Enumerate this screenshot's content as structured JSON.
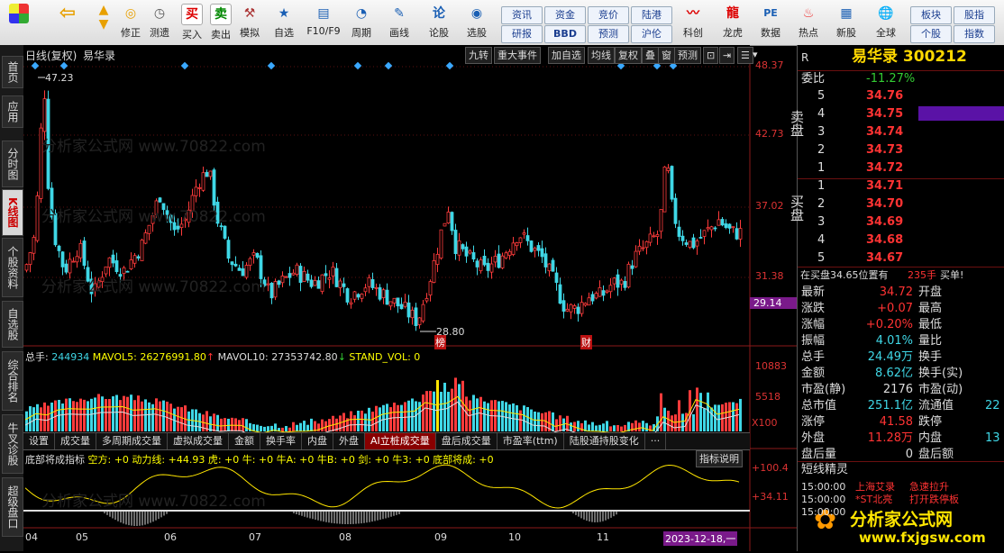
{
  "toolbar": {
    "items": [
      "修正",
      "测遗",
      "买入",
      "卖出",
      "模拟",
      "自选",
      "F10/F9",
      "周期",
      "画线",
      "论股",
      "选股",
      "科创",
      "龙虎",
      "数据",
      "热点",
      "新股",
      "全球"
    ],
    "small_buttons": [
      "资讯",
      "资金",
      "竞价",
      "陆港",
      "研报",
      "BBD",
      "预测",
      "沪伦",
      "板块",
      "股指",
      "个股",
      "指数"
    ]
  },
  "leftnav": [
    "首页",
    "应用",
    "分时图",
    "K线图",
    "个股资料",
    "自选股",
    "综合排名",
    "牛叉诊股",
    "超级盘口"
  ],
  "chart_header": {
    "mode": "日线(复权)",
    "name": "易华录"
  },
  "chart_buttons": [
    "九转",
    "重大事件",
    "加自选",
    "均线",
    "复权",
    "叠",
    "窗",
    "预测"
  ],
  "price_axis": [
    "48.37",
    "42.73",
    "37.02",
    "31.38",
    "29.14"
  ],
  "annotations": {
    "high": "47.23",
    "low": "28.80",
    "marker1": "榜",
    "marker2": "财"
  },
  "watermark": "分析家公式网 www.70822.com",
  "volume_header": {
    "label": "总手:",
    "v": "244934",
    "mavol5": "MAVOL5: 26276991.80",
    "mavol10": "MAVOL10: 27353742.80",
    "stand": "STAND_VOL: 0"
  },
  "volume_axis": [
    "10883",
    "5518",
    "X100"
  ],
  "sub_tabs": [
    "设置",
    "成交量",
    "多周期成交量",
    "虚拟成交量",
    "金额",
    "换手率",
    "内盘",
    "外盘",
    "AI立桩成交量",
    "盘后成交量",
    "市盈率(ttm)",
    "陆股通持股变化",
    "···"
  ],
  "indicator_header": {
    "name": "底部将成指标",
    "text": "空方: +0  动力线: +44.93  虎: +0  牛: +0  牛A: +0  牛B: +0  剑: +0  牛3: +0  底部将成: +0",
    "button": "指标说明"
  },
  "indicator_axis": [
    "+100.4",
    "+34.11"
  ],
  "dates": [
    "04",
    "05",
    "06",
    "07",
    "08",
    "09",
    "10",
    "11",
    "2023-12-18,一"
  ],
  "stock": {
    "title": "易华录 300212",
    "r": "R",
    "weibi_label": "委比",
    "weibi": "-11.27%"
  },
  "sell": [
    {
      "n": "5",
      "p": "34.76"
    },
    {
      "n": "4",
      "p": "34.75"
    },
    {
      "n": "3",
      "p": "34.74"
    },
    {
      "n": "2",
      "p": "34.73"
    },
    {
      "n": "1",
      "p": "34.72"
    }
  ],
  "buy": [
    {
      "n": "1",
      "p": "34.71"
    },
    {
      "n": "2",
      "p": "34.70"
    },
    {
      "n": "3",
      "p": "34.69"
    },
    {
      "n": "4",
      "p": "34.68"
    },
    {
      "n": "5",
      "p": "34.67"
    }
  ],
  "sell_label": "卖盘",
  "buy_label": "买盘",
  "tick": {
    "text": "在买盘34.65位置有",
    "amt": "235手",
    "tag": "买单!"
  },
  "quote": [
    {
      "k": "最新",
      "v": "34.72",
      "k2": "开盘"
    },
    {
      "k": "涨跌",
      "v": "+0.07",
      "k2": "最高"
    },
    {
      "k": "涨幅",
      "v": "+0.20%",
      "k2": "最低"
    },
    {
      "k": "振幅",
      "v": "4.01%",
      "k2": "量比"
    },
    {
      "k": "总手",
      "v": "24.49万",
      "k2": "换手"
    },
    {
      "k": "金额",
      "v": "8.62亿",
      "k2": "换手(实)"
    },
    {
      "k": "市盈(静)",
      "v": "2176",
      "k2": "市盈(动)"
    },
    {
      "k": "总市值",
      "v": "251.1亿",
      "k2": "流通值",
      "v2": "22"
    },
    {
      "k": "涨停",
      "v": "41.58",
      "k2": "跌停"
    },
    {
      "k": "外盘",
      "v": "11.28万",
      "k2": "内盘",
      "v2": "13"
    },
    {
      "k": "盘后量",
      "v": "0",
      "k2": "盘后额"
    }
  ],
  "short_title": "短线精灵",
  "short_list": [
    {
      "t": "15:00:00",
      "s": "上海艾录",
      "e": "急速拉升"
    },
    {
      "t": "15:00:00",
      "s": "*ST北亮",
      "e": "打开跌停板"
    },
    {
      "t": "15:00:00",
      "s": "",
      "e": ""
    }
  ],
  "logo": {
    "text": "分析家公式网",
    "url": "www.fxjgsw.com"
  },
  "colors": {
    "up": "#ff3b3b",
    "down": "#3fd7e6",
    "accent": "#c00"
  }
}
